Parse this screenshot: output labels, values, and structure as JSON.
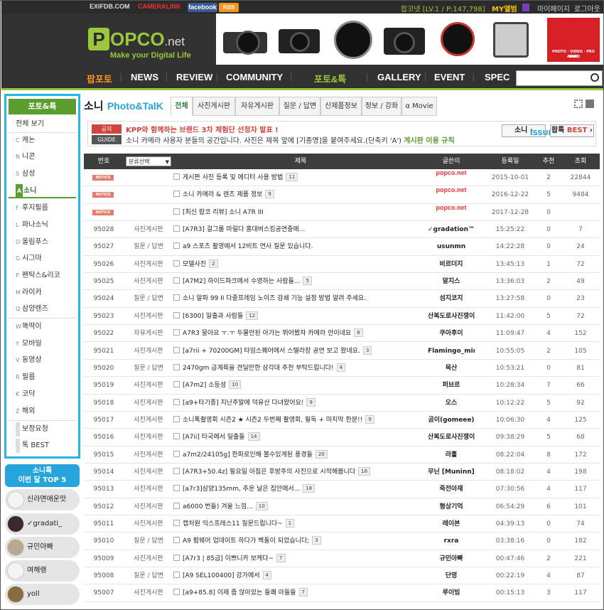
{
  "topbar": {
    "logos": [
      "EXIFDB.COM",
      "CAMERALINK"
    ],
    "facebook": "facebook",
    "rss": "RSS",
    "user": "팝코넷 [LV.1 / P:147,798]",
    "myalbum": "MY앨범",
    "mypage": "마이페이지",
    "logout": "로그아웃"
  },
  "header": {
    "logo_main": "OPCO",
    "logo_letter": "P",
    "logo_suffix": ".net",
    "tagline": "Make your Digital Life",
    "ad_brand": "B&H",
    "ad_brand_sub": "PHOTO · VIDEO · PRO AUDIO"
  },
  "nav": [
    "팝포토",
    "NEWS",
    "REVIEW",
    "COMMUNITY",
    "포토&톡",
    "GALLERY",
    "EVENT",
    "SPEC"
  ],
  "sidebar": {
    "title": "포토&톡",
    "items": [
      {
        "key": "",
        "label": "전체 보기"
      },
      {
        "key": "C",
        "label": "캐논"
      },
      {
        "key": "N",
        "label": "니콘"
      },
      {
        "key": "S",
        "label": "삼성"
      },
      {
        "key": "A",
        "label": "소니"
      },
      {
        "key": "F",
        "label": "후지필름"
      },
      {
        "key": "L",
        "label": "파나소닉"
      },
      {
        "key": "O",
        "label": "올림푸스"
      },
      {
        "key": "G",
        "label": "시그마"
      },
      {
        "key": "P",
        "label": "펜탁스&리코"
      },
      {
        "key": "M",
        "label": "라이카"
      },
      {
        "key": "Q",
        "label": "삼양렌즈"
      },
      {
        "key": "W",
        "label": "똑딱이"
      },
      {
        "key": "Y",
        "label": "모바일"
      },
      {
        "key": "V",
        "label": "동영상"
      },
      {
        "key": "R",
        "label": "필름"
      },
      {
        "key": "K",
        "label": "코닥"
      },
      {
        "key": "Z",
        "label": "해외"
      },
      {
        "key": "",
        "label": "보정요청"
      },
      {
        "key": "",
        "label": "톡 BEST"
      }
    ]
  },
  "top5": {
    "title_line1": "소니톡",
    "title_line2": "이번 달 TOP 5",
    "users": [
      "신라면매운맛",
      "✓gradati_",
      "규민아빠",
      "여해랭",
      "yoll"
    ]
  },
  "main": {
    "title": "소니",
    "title_en": "Photo&TalK",
    "tabs": [
      "전체",
      "사진게시판",
      "자유게시판",
      "질문 / 답변",
      "신제품정보",
      "정보 / 강좌",
      "α Movie"
    ]
  },
  "notice": {
    "label1": "공지",
    "text1": "KPP와 함께하는 브랜드 3차 체험단 선정자 발표 !",
    "label2": "GUIDE",
    "text2": "소니 카메라 사용자 분들의 공간입니다. 사진은 제목 앞에 [기종명]을 붙여주세요.(단축키 'A')",
    "text2_link": "게시판 이용 규칙",
    "btn_issue_a": "소니",
    "btn_issue_b": "ISSUE",
    "btn_best_a": "팝톡",
    "btn_best_b": "BEST"
  },
  "table": {
    "headers": {
      "num": "번호",
      "category": "분류선택",
      "subject": "제목",
      "author": "글쓴이",
      "date": "등록일",
      "recommend": "추천",
      "views": "조회"
    },
    "notice_badge": "NOTICE",
    "rows": [
      {
        "num": "",
        "notice": true,
        "category": "",
        "subject": "게시판 사진 등록 및 에디터 사용 방법",
        "count": "11",
        "author": "popco.net",
        "date": "2015-10-01",
        "rec": "2",
        "views": "22844"
      },
      {
        "num": "",
        "notice": true,
        "category": "",
        "subject": "소니 카메라 & 렌즈 제품 정보",
        "count": "9",
        "author": "popco.net",
        "date": "2016-12-22",
        "rec": "5",
        "views": "9484"
      },
      {
        "num": "",
        "notice": true,
        "category": "",
        "subject": "[최신 팝코 리뷰] 소니 A7R III",
        "count": "",
        "author": "popco.net",
        "date": "2017-12-28",
        "rec": "0",
        "views": ""
      },
      {
        "num": "95028",
        "category": "사진게시판",
        "subject": "[A7R3] 걸그룹 마릴다 홍대버스킹공연중에...",
        "count": "",
        "author": "✓gradation™",
        "date": "15:25:22",
        "rec": "0",
        "views": "7"
      },
      {
        "num": "95027",
        "category": "질문 / 답변",
        "subject": "a9 스포츠 촬영에서 12비트 연사 질문 있습니다.",
        "count": "",
        "author": "usunmn",
        "date": "14:22:28",
        "rec": "0",
        "views": "24"
      },
      {
        "num": "95026",
        "category": "사진게시판",
        "subject": "모델사진",
        "count": "2",
        "author": "비르더지",
        "date": "13:45:13",
        "rec": "1",
        "views": "72"
      },
      {
        "num": "95025",
        "category": "사진게시판",
        "subject": "[A7M2] 하이드파크에서 수영하는 사람들...",
        "count": "5",
        "author": "알지스",
        "date": "13:36:03",
        "rec": "2",
        "views": "49"
      },
      {
        "num": "95024",
        "category": "질문 / 답변",
        "subject": "소니 알파 99 II 다중프레임 노이즈 감쇄 기능 설정 방법 알려 주세요.",
        "count": "",
        "author": "섬지코지",
        "date": "13:27:58",
        "rec": "0",
        "views": "23"
      },
      {
        "num": "95023",
        "category": "사진게시판",
        "subject": "[6300] 일출과 사람들",
        "count": "12",
        "author": "산복도로사진쟁이",
        "date": "11:42:00",
        "rec": "5",
        "views": "72"
      },
      {
        "num": "95022",
        "category": "자유게시판",
        "subject": "A7R3 뭉아요 ㅜ.ㅜ 두물안된 아가는 뛰어봤자 카메라 안이네요",
        "count": "8",
        "author": "쿠아후이",
        "date": "11:09:47",
        "rec": "4",
        "views": "152"
      },
      {
        "num": "95021",
        "category": "사진게시판",
        "subject": "[a7rii + 70200GM] 타임스퀘어에서 스텔라장 공연 보고 왔네요.",
        "count": "3",
        "author": "Flamingo_ming",
        "date": "10:55:05",
        "rec": "2",
        "views": "105"
      },
      {
        "num": "95020",
        "category": "질문 / 답변",
        "subject": "2470gm 금계륵을 견딜만한 삼각대 추천 부탁드립니다!",
        "count": "4",
        "author": "묵산",
        "date": "10:53:21",
        "rec": "0",
        "views": "81"
      },
      {
        "num": "95019",
        "category": "사진게시판",
        "subject": "[A7m2] 소등섬",
        "count": "10",
        "author": "퍼브르",
        "date": "10:28:34",
        "rec": "7",
        "views": "66"
      },
      {
        "num": "95018",
        "category": "사진게시판",
        "subject": "[a9+타기종] 지난주말에 덕유산 다녀왔어요!",
        "count": "9",
        "author": "오스",
        "date": "10:12:22",
        "rec": "5",
        "views": "92"
      },
      {
        "num": "95017",
        "category": "사진게시판",
        "subject": "소니톡촬영회 시즌2 ★ 시즌2 두번째 촬영회, 필독 + 마지막 한분!!",
        "count": "9",
        "author": "곰이(gomeee)",
        "date": "10:06:30",
        "rec": "4",
        "views": "125"
      },
      {
        "num": "95016",
        "category": "사진게시판",
        "subject": "[A7ii] 타국에서 일출들",
        "count": "14",
        "author": "산복도로사진쟁이",
        "date": "09:38:29",
        "rec": "5",
        "views": "68"
      },
      {
        "num": "95015",
        "category": "사진게시판",
        "subject": "a7m2/24105g] 한파로인해 볼수있게된 풍경들",
        "count": "20",
        "author": "라흘",
        "date": "08:22:04",
        "rec": "8",
        "views": "172"
      },
      {
        "num": "95014",
        "category": "사진게시판",
        "subject": "[A7R3+50.4z] 필요일 아침은 후방주의 사진으로 시작해봅니다",
        "count": "18",
        "author": "무닌 [Muninn]",
        "date": "08:18:02",
        "rec": "4",
        "views": "198"
      },
      {
        "num": "95013",
        "category": "사진게시판",
        "subject": "[a7r3]삼양135mm, 추운 날은 집안에서...",
        "count": "18",
        "author": "죽전아재",
        "date": "07:30:56",
        "rec": "4",
        "views": "117"
      },
      {
        "num": "95012",
        "category": "사진게시판",
        "subject": "a6000 번들) 겨울 느낌...",
        "count": "10",
        "author": "형상기억",
        "date": "06:54:29",
        "rec": "6",
        "views": "101"
      },
      {
        "num": "95011",
        "category": "사진게시판",
        "subject": "캡처원 익스프레스11 질문드립니다~",
        "count": "1",
        "author": "레이븐",
        "date": "04:39:13",
        "rec": "0",
        "views": "74"
      },
      {
        "num": "95010",
        "category": "질문 / 답변",
        "subject": "A9 펌웨어 업데이트 하다가 벽돌이 되었습니다;",
        "count": "3",
        "author": "rxra",
        "date": "03:38:16",
        "rec": "0",
        "views": "182"
      },
      {
        "num": "95009",
        "category": "사진게시판",
        "subject": "[A7r3 | 85금] 이쁘니카 보케다~",
        "count": "7",
        "author": "규민아빠",
        "date": "00:47:46",
        "rec": "2",
        "views": "221"
      },
      {
        "num": "95008",
        "category": "질문 / 답변",
        "subject": "[A9 SEL100400] 강가에서",
        "count": "4",
        "author": "단영",
        "date": "00:22:19",
        "rec": "4",
        "views": "87"
      },
      {
        "num": "95007",
        "category": "사진게시판",
        "subject": "[a9+85.8] 이제 좀 앉아있는 들쾌 아들들",
        "count": "7",
        "author": "루이빔",
        "date": "00:15:13",
        "rec": "3",
        "views": "117"
      }
    ]
  }
}
